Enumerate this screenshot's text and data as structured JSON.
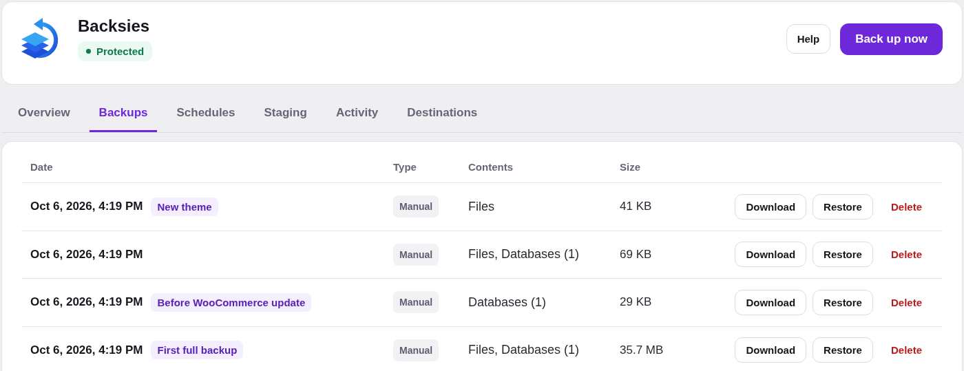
{
  "app": {
    "title": "Backsies",
    "status": {
      "label": "Protected",
      "color": "#12774f"
    }
  },
  "header_buttons": [
    {
      "label": "Help",
      "kind": "secondary"
    },
    {
      "label": "Back up now",
      "kind": "primary"
    }
  ],
  "tabs": [
    {
      "label": "Overview",
      "selected": false
    },
    {
      "label": "Backups",
      "selected": true
    },
    {
      "label": "Schedules",
      "selected": false
    },
    {
      "label": "Staging",
      "selected": false
    },
    {
      "label": "Activity",
      "selected": false
    },
    {
      "label": "Destinations",
      "selected": false
    }
  ],
  "table": {
    "columns": [
      "Date",
      "Type",
      "Contents",
      "Size"
    ],
    "rows": [
      {
        "date": "Oct 6, 2026, 4:19 PM",
        "note": "New theme",
        "type": "Manual",
        "contents": "Files",
        "size": "41 KB",
        "actions": [
          {
            "label": "Download",
            "kind": "download"
          },
          {
            "label": "Restore",
            "kind": "restore"
          },
          {
            "label": "Delete",
            "kind": "delete"
          }
        ]
      },
      {
        "date": "Oct 6, 2026, 4:19 PM",
        "type": "Manual",
        "contents": "Files, Databases (1)",
        "size": "69 KB",
        "actions": [
          {
            "label": "Download",
            "kind": "download"
          },
          {
            "label": "Restore",
            "kind": "restore"
          },
          {
            "label": "Delete",
            "kind": "delete"
          }
        ]
      },
      {
        "date": "Oct 6, 2026, 4:19 PM",
        "note": "Before WooCommerce update",
        "type": "Manual",
        "contents": "Databases (1)",
        "size": "29 KB",
        "actions": [
          {
            "label": "Download",
            "kind": "download"
          },
          {
            "label": "Restore",
            "kind": "restore"
          },
          {
            "label": "Delete",
            "kind": "delete"
          }
        ]
      },
      {
        "date": "Oct 6, 2026, 4:19 PM",
        "note": "First full backup",
        "type": "Manual",
        "contents": "Files, Databases (1)",
        "size": "35.7 MB",
        "actions": [
          {
            "label": "Download",
            "kind": "download"
          },
          {
            "label": "Restore",
            "kind": "restore"
          },
          {
            "label": "Delete",
            "kind": "delete"
          }
        ]
      }
    ]
  }
}
